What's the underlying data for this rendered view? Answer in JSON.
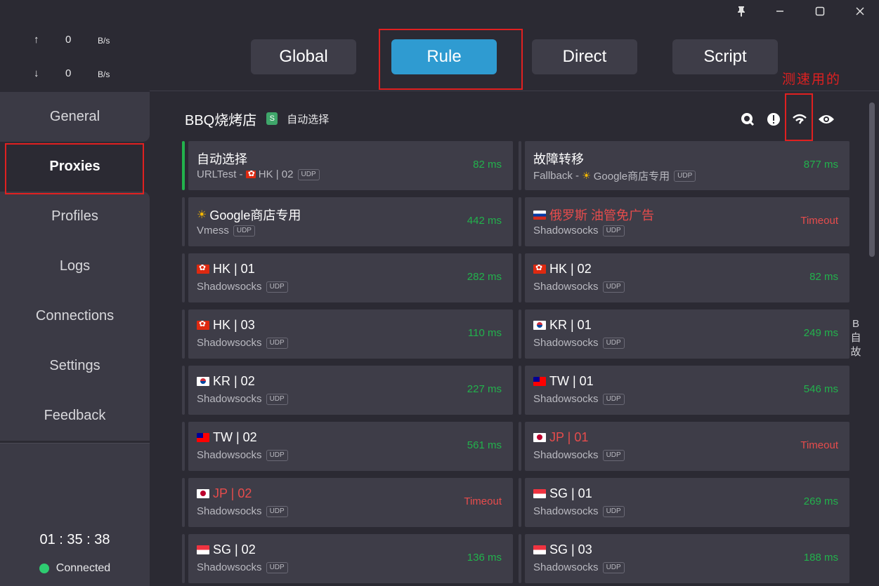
{
  "window": {
    "pin_icon": "pin-icon",
    "minimize_icon": "minimize-icon",
    "maximize_icon": "maximize-icon",
    "close_icon": "close-icon"
  },
  "traffic": {
    "up_arrow": "↑",
    "up_value": "0",
    "up_unit": "B/s",
    "down_arrow": "↓",
    "down_value": "0",
    "down_unit": "B/s"
  },
  "nav": {
    "general": "General",
    "proxies": "Proxies",
    "profiles": "Profiles",
    "logs": "Logs",
    "connections": "Connections",
    "settings": "Settings",
    "feedback": "Feedback"
  },
  "status": {
    "timer": "01 : 35 : 38",
    "connection": "Connected"
  },
  "modes": {
    "global": "Global",
    "rule": "Rule",
    "direct": "Direct",
    "script": "Script",
    "active": "Rule"
  },
  "annotation": "测速用的",
  "group": {
    "name": "BBQ烧烤店",
    "badge": "S",
    "selected": "自动选择"
  },
  "side_letters": [
    "B",
    "自",
    "故"
  ],
  "proxies": [
    {
      "name": "自动选择",
      "type": "URLTest - ",
      "via_flag": "hk",
      "via": "HK | 02",
      "udp": "UDP",
      "delay": "82 ms",
      "timeout": false,
      "selected": true,
      "flag": ""
    },
    {
      "name": "故障转移",
      "type": "Fallback - ",
      "via_sun": true,
      "via": "Google商店专用",
      "udp": "UDP",
      "delay": "877 ms",
      "timeout": false,
      "selected": false,
      "flag": ""
    },
    {
      "name": "Google商店专用",
      "sun": true,
      "type": "Vmess",
      "udp": "UDP",
      "delay": "442 ms",
      "timeout": false,
      "flag": ""
    },
    {
      "name": "俄罗斯 油管免广告",
      "type": "Shadowsocks",
      "udp": "UDP",
      "delay": "Timeout",
      "timeout": true,
      "flag": "ru"
    },
    {
      "name": "HK | 01",
      "type": "Shadowsocks",
      "udp": "UDP",
      "delay": "282 ms",
      "timeout": false,
      "flag": "hk"
    },
    {
      "name": "HK | 02",
      "type": "Shadowsocks",
      "udp": "UDP",
      "delay": "82 ms",
      "timeout": false,
      "flag": "hk"
    },
    {
      "name": "HK | 03",
      "type": "Shadowsocks",
      "udp": "UDP",
      "delay": "110 ms",
      "timeout": false,
      "flag": "hk"
    },
    {
      "name": "KR | 01",
      "type": "Shadowsocks",
      "udp": "UDP",
      "delay": "249 ms",
      "timeout": false,
      "flag": "kr"
    },
    {
      "name": "KR | 02",
      "type": "Shadowsocks",
      "udp": "UDP",
      "delay": "227 ms",
      "timeout": false,
      "flag": "kr"
    },
    {
      "name": "TW | 01",
      "type": "Shadowsocks",
      "udp": "UDP",
      "delay": "546 ms",
      "timeout": false,
      "flag": "tw"
    },
    {
      "name": "TW | 02",
      "type": "Shadowsocks",
      "udp": "UDP",
      "delay": "561 ms",
      "timeout": false,
      "flag": "tw"
    },
    {
      "name": "JP | 01",
      "type": "Shadowsocks",
      "udp": "UDP",
      "delay": "Timeout",
      "timeout": true,
      "flag": "jp"
    },
    {
      "name": "JP | 02",
      "type": "Shadowsocks",
      "udp": "UDP",
      "delay": "Timeout",
      "timeout": true,
      "flag": "jp"
    },
    {
      "name": "SG | 01",
      "type": "Shadowsocks",
      "udp": "UDP",
      "delay": "269 ms",
      "timeout": false,
      "flag": "sg"
    },
    {
      "name": "SG | 02",
      "type": "Shadowsocks",
      "udp": "UDP",
      "delay": "136 ms",
      "timeout": false,
      "flag": "sg"
    },
    {
      "name": "SG | 03",
      "type": "Shadowsocks",
      "udp": "UDP",
      "delay": "188 ms",
      "timeout": false,
      "flag": "sg"
    }
  ],
  "colors": {
    "accent": "#2f9bd1",
    "ok": "#22b24c",
    "timeout": "#e74c4c",
    "annotation": "#e02020"
  }
}
